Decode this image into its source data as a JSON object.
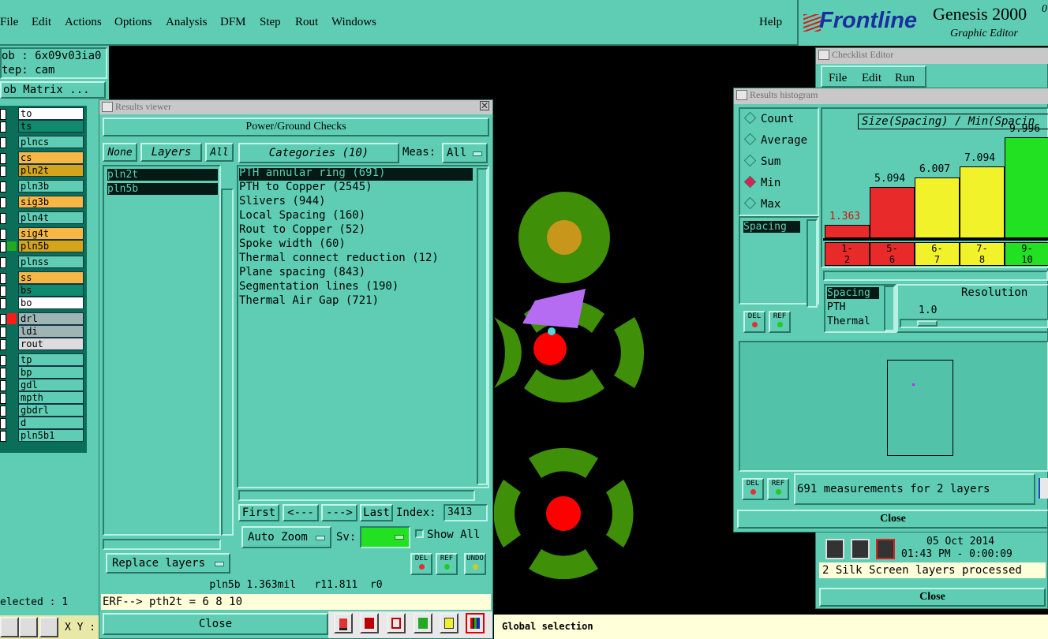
{
  "menubar": {
    "items": [
      "File",
      "Edit",
      "Actions",
      "Options",
      "Analysis",
      "DFM",
      "Step",
      "Rout",
      "Windows"
    ],
    "help": "Help"
  },
  "logo": {
    "brand": "Frontline",
    "product": "Genesis 2000",
    "product_suffix": "0",
    "subtitle": "Graphic Editor"
  },
  "job": {
    "job_line": "ob : 6x09v03ia0",
    "step_line": "tep: cam",
    "matrix_button": "ob Matrix ...",
    "selected": "elected : 1",
    "xy_label": "X Y :"
  },
  "layers": [
    {
      "name": "to",
      "color": "#ffffff"
    },
    {
      "name": "ts",
      "color": "#0f8a6c"
    },
    {
      "name": "plncs",
      "color": "#5ecdb3"
    },
    {
      "name": "cs",
      "color": "#f7b744"
    },
    {
      "name": "pln2t",
      "color": "#d4a51a"
    },
    {
      "name": "pln3b",
      "color": "#5ecdb3"
    },
    {
      "name": "sig3b",
      "color": "#f7b744"
    },
    {
      "name": "pln4t",
      "color": "#5ecdb3"
    },
    {
      "name": "sig4t",
      "color": "#f7b744"
    },
    {
      "name": "pln5b",
      "color": "#d4a51a"
    },
    {
      "name": "plnss",
      "color": "#5ecdb3"
    },
    {
      "name": "ss",
      "color": "#f7b744"
    },
    {
      "name": "bs",
      "color": "#0f8a6c"
    },
    {
      "name": "bo",
      "color": "#ffffff"
    },
    {
      "name": "drl",
      "color": "#9fb5b3"
    },
    {
      "name": "ldi",
      "color": "#9fb5b3"
    },
    {
      "name": "rout",
      "color": "#dcdcdc"
    },
    {
      "name": "tp",
      "color": "#5ecdb3"
    },
    {
      "name": "bp",
      "color": "#5ecdb3"
    },
    {
      "name": "gdl",
      "color": "#5ecdb3"
    },
    {
      "name": "mpth",
      "color": "#5ecdb3"
    },
    {
      "name": "gbdrl",
      "color": "#5ecdb3"
    },
    {
      "name": "d",
      "color": "#5ecdb3"
    },
    {
      "name": "pln5b1",
      "color": "#5ecdb3"
    }
  ],
  "results_viewer": {
    "title": "Results viewer",
    "heading": "Power/Ground Checks",
    "none_btn": "None",
    "layers_label": "Layers",
    "all_btn": "All",
    "layer_list": [
      "pln2t",
      "pln5b"
    ],
    "categories_label": "Categories (10)",
    "meas_label": "Meas:",
    "meas_value": "All",
    "categories": [
      "PTH annular ring (691)",
      "PTH to Copper (2545)",
      "Slivers (944)",
      "Local Spacing (160)",
      "Rout to Copper (52)",
      "Spoke width (60)",
      "Thermal connect reduction (12)",
      "Plane spacing (843)",
      "Segmentation lines (190)",
      "Thermal Air Gap (721)"
    ],
    "nav": {
      "first": "First",
      "prev": "<---",
      "next": "--->",
      "last": "Last",
      "index_label": "Index:",
      "index_value": "3413"
    },
    "auto_zoom": "Auto Zoom",
    "sv_label": "Sv:",
    "show_all": "Show All",
    "replace_layers": "Replace layers",
    "status_line": "pln5b 1.363mil   r11.811  r0",
    "erf_line": "ERF--> pth2t = 6 8 10",
    "close": "Close",
    "del": "DEL",
    "ref": "REF",
    "undo": "UNDO"
  },
  "global_selection": "Global selection",
  "checklist": {
    "title": "Checklist Editor",
    "menu": [
      "File",
      "Edit",
      "Run"
    ],
    "date": "05 Oct 2014",
    "time": "01:43 PM - 0:00:09",
    "message": "2 Silk Screen layers processed",
    "close": "Close"
  },
  "histogram": {
    "title": "Results histogram",
    "options": [
      "Count",
      "Average",
      "Sum",
      "Min",
      "Max"
    ],
    "selected_option": "Min",
    "list_selected": "Spacing",
    "list2": [
      "Spacing",
      "PTH",
      "Thermal"
    ],
    "resolution_label": "Resolution",
    "resolution_value": "1.0",
    "footer": "691 measurements for 2 layers",
    "close": "Close"
  },
  "chart_data": {
    "type": "bar",
    "title": "Size(Spacing) / Min(Spacin",
    "categories": [
      "1-\n2",
      "5-\n6",
      "6-\n7",
      "7-\n8",
      "9-\n10"
    ],
    "values": [
      1.363,
      5.094,
      6.007,
      7.094,
      9.996
    ],
    "value_labels": [
      "1.363",
      "5.094",
      "6.007",
      "7.094",
      "9.996"
    ],
    "colors": [
      "#e82a2a",
      "#e82a2a",
      "#f2f22a",
      "#f2f22a",
      "#22e022"
    ],
    "label_colors": [
      "#d41010",
      "#000000",
      "#000000",
      "#000000",
      "#000000"
    ],
    "ylim": [
      0,
      10
    ]
  },
  "colors": {
    "panel": "#5ecdb3",
    "canvas": "#000000",
    "pad_green": "#3f8f08",
    "pad_red": "#ff0000",
    "pad_gold": "#c8961a",
    "highlight_purple": "#b56cf2"
  }
}
